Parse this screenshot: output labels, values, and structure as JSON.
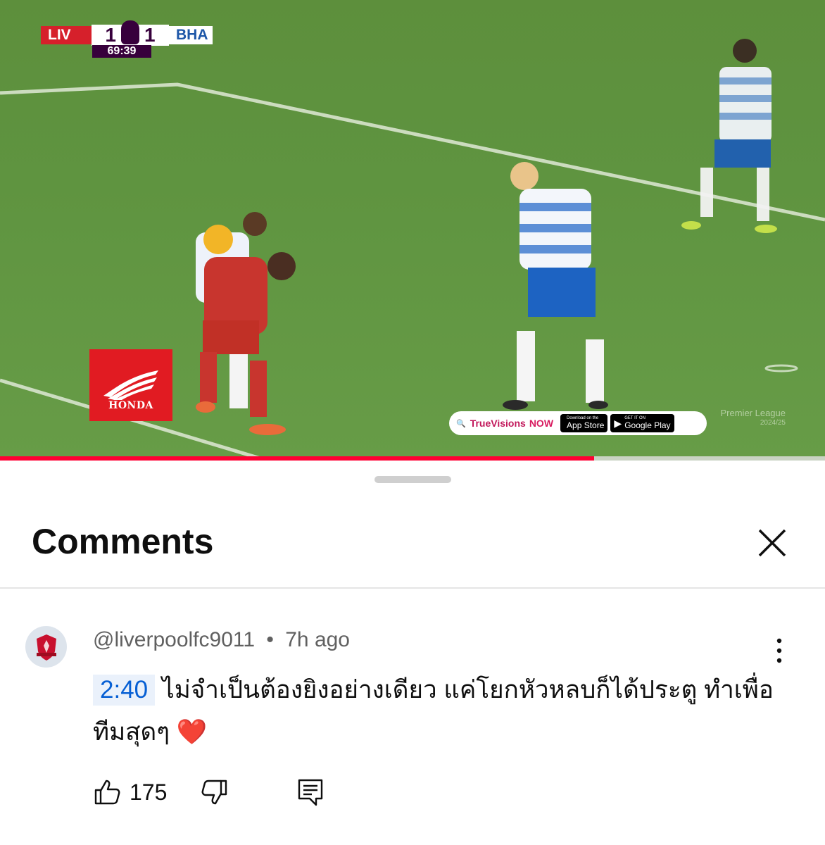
{
  "video": {
    "scorebug": {
      "home_team": "LIV",
      "home_score": "1",
      "away_score": "1",
      "away_team": "BHA",
      "clock": "69:39"
    },
    "sponsor_label": "HONDA",
    "ad_pill": {
      "brand": "TrueVisions",
      "brand_suffix": "NOW",
      "appstore_small": "Download on the",
      "appstore_big": "App Store",
      "googleplay_small": "GET IT ON",
      "googleplay_big": "Google Play"
    },
    "watermark": {
      "line1": "Premier League",
      "line2": "2024/25"
    },
    "progress_fraction": 0.72,
    "colors": {
      "progress": "#ff0033",
      "liverpool_red": "#d6202b",
      "pl_purple": "#37003c"
    }
  },
  "sheet": {
    "title": "Comments",
    "comment": {
      "author": "@liverpoolfc9011",
      "age": "7h ago",
      "timestamp_link": "2:40",
      "text": "ไม่จำเป็นต้องยิงอย่างเดียว แค่โยกหัวหลบก็ได้ประตู ทำเพื่อทีมสุดๆ",
      "emoji": "❤️",
      "likes": "175"
    },
    "colors": {
      "link_blue": "#065fd4",
      "meta_gray": "#606060"
    }
  }
}
